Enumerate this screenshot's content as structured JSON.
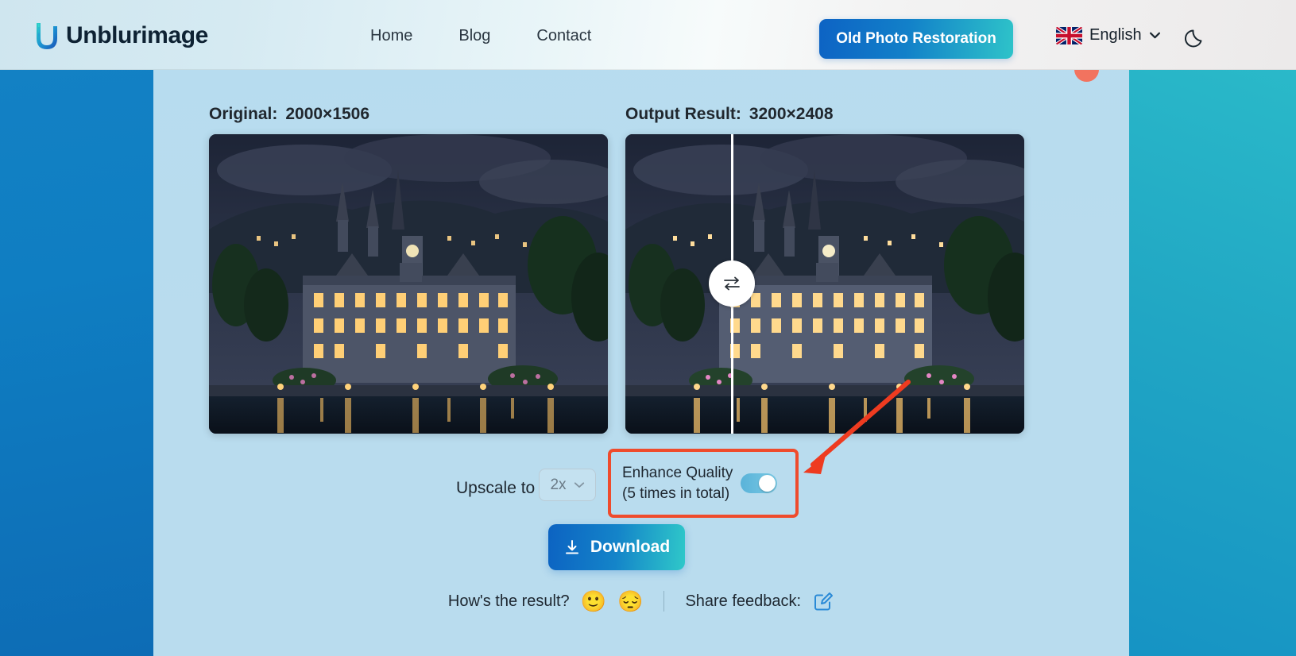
{
  "header": {
    "logo_text": "Unblurimage",
    "logo_icon": "u-wave-logo-icon",
    "nav": [
      {
        "label": "Home"
      },
      {
        "label": "Blog"
      },
      {
        "label": "Contact"
      }
    ],
    "cta_label": "Old Photo Restoration",
    "language": {
      "label": "English",
      "flag_icon": "uk-flag-icon",
      "caret_icon": "chevron-down-icon"
    },
    "theme_icon": "moon-icon"
  },
  "main": {
    "original": {
      "label": "Original:",
      "dimensions": "2000×1506"
    },
    "output": {
      "label": "Output Result:",
      "dimensions": "3200×2408"
    },
    "compare_handle_icon": "swap-arrows-icon"
  },
  "controls": {
    "upscale_label": "Upscale to",
    "upscale_value": "2x",
    "upscale_caret_icon": "chevron-down-icon",
    "enhance_title": "Enhance Quality",
    "enhance_subtitle": "(5 times in total)",
    "enhance_toggle_state": "on",
    "highlight_color": "#ef4b2c",
    "annotation_arrow_icon": "red-arrow-icon"
  },
  "download": {
    "label": "Download",
    "icon": "download-icon"
  },
  "feedback": {
    "question": "How's the result?",
    "happy_emoji": "🙂",
    "sad_emoji": "😔",
    "share_label": "Share feedback:",
    "edit_icon": "edit-square-icon"
  },
  "colors": {
    "accent_blue": "#0d63c4",
    "accent_teal": "#2ec3c9",
    "page_bg": "#b9dcee",
    "band_left": "#0f7ec2",
    "band_right": "#21a7c4",
    "highlight_red": "#ef4b2c",
    "notify_dot": "#f8674f"
  }
}
